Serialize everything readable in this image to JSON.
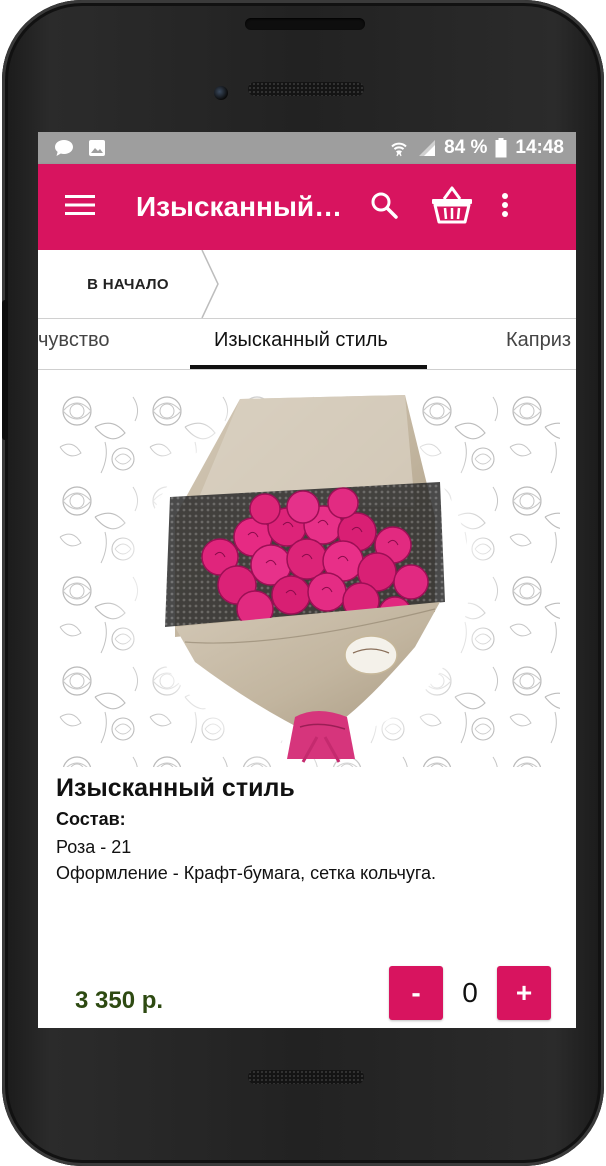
{
  "status_bar": {
    "battery": "84 %",
    "time": "14:48",
    "icons": [
      "chat-icon",
      "image-icon",
      "wifi-icon",
      "signal-icon",
      "battery-icon"
    ]
  },
  "app_bar": {
    "title": "Изысканный…",
    "icons": [
      "menu-icon",
      "search-icon",
      "basket-icon",
      "more-vert-icon"
    ],
    "color": "#d8145f"
  },
  "breadcrumb": {
    "home_label": "В НАЧАЛО"
  },
  "tabs": {
    "prev": "чувство",
    "active": "Изысканный стиль",
    "next": "Каприз"
  },
  "product": {
    "title": "Изысканный стиль",
    "composition_label": "Состав:",
    "composition": [
      "Роза - 21",
      "Оформление - Крафт-бумага, сетка кольчуга."
    ],
    "price": "3 350 р.",
    "quantity": "0",
    "minus_label": "-",
    "plus_label": "+"
  },
  "colors": {
    "accent": "#d8145f",
    "price": "#2e4a12",
    "status_bar": "#9e9e9e"
  }
}
